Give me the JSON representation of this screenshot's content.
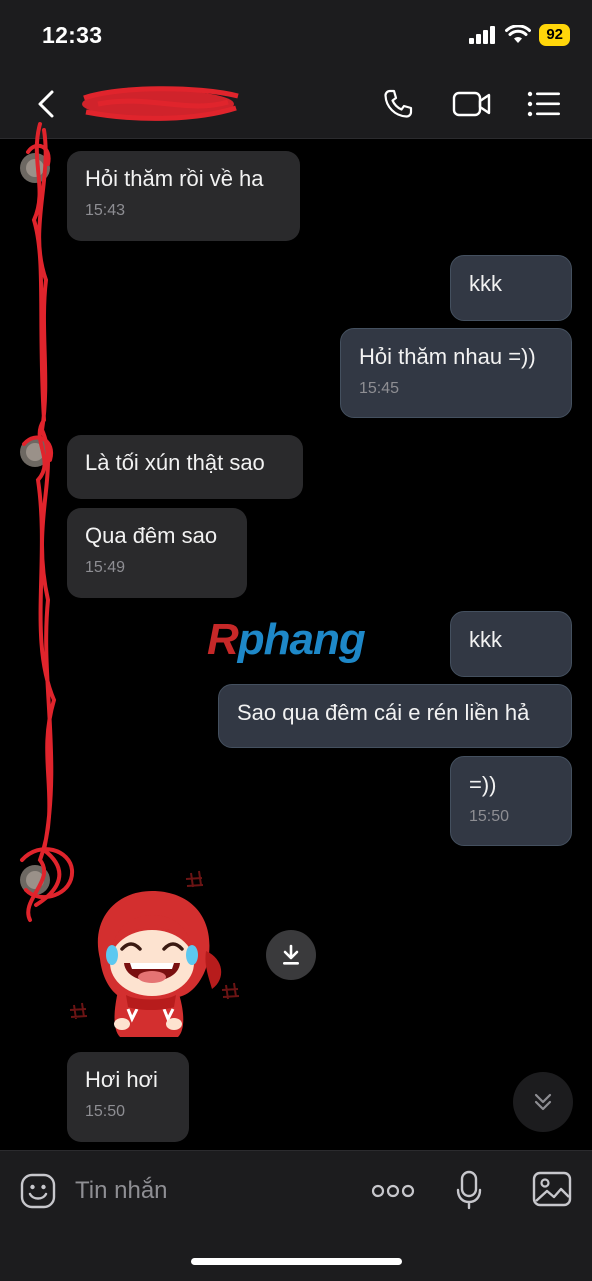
{
  "status_bar": {
    "time": "12:33",
    "battery": "92"
  },
  "header": {
    "contact_name_redacted": true
  },
  "messages": [
    {
      "side": "in",
      "text": "Hỏi thăm rồi về ha",
      "time": "15:43"
    },
    {
      "side": "out",
      "text": "kkk"
    },
    {
      "side": "out",
      "text": "Hỏi thăm nhau =))",
      "time": "15:45"
    },
    {
      "side": "in",
      "text": "Là tối xún thật sao"
    },
    {
      "side": "in",
      "text": "Qua đêm sao",
      "time": "15:49"
    },
    {
      "side": "out",
      "text": "kkk"
    },
    {
      "side": "out",
      "text": "Sao qua đêm cái e rén liền hả"
    },
    {
      "side": "out",
      "text": "=))",
      "time": "15:50"
    },
    {
      "side": "in",
      "type": "sticker",
      "sticker": "laughing-red-hood-sticker"
    },
    {
      "side": "in",
      "text": "Hơi hơi",
      "time": "15:50"
    }
  ],
  "watermark": {
    "part1": "R",
    "part2": "phang"
  },
  "composer": {
    "placeholder": "Tin nhắn"
  },
  "colors": {
    "background": "#000000",
    "bar": "#1c1c1e",
    "incoming_bubble": "#2a2a2c",
    "outgoing_bubble": "#323844",
    "battery": "#ffd60a",
    "redaction": "#e0242c"
  },
  "icons": [
    "back-icon",
    "phone-icon",
    "video-icon",
    "menu-icon",
    "download-icon",
    "scroll-down-icon",
    "emoji-icon",
    "more-icon",
    "mic-icon",
    "image-icon"
  ]
}
